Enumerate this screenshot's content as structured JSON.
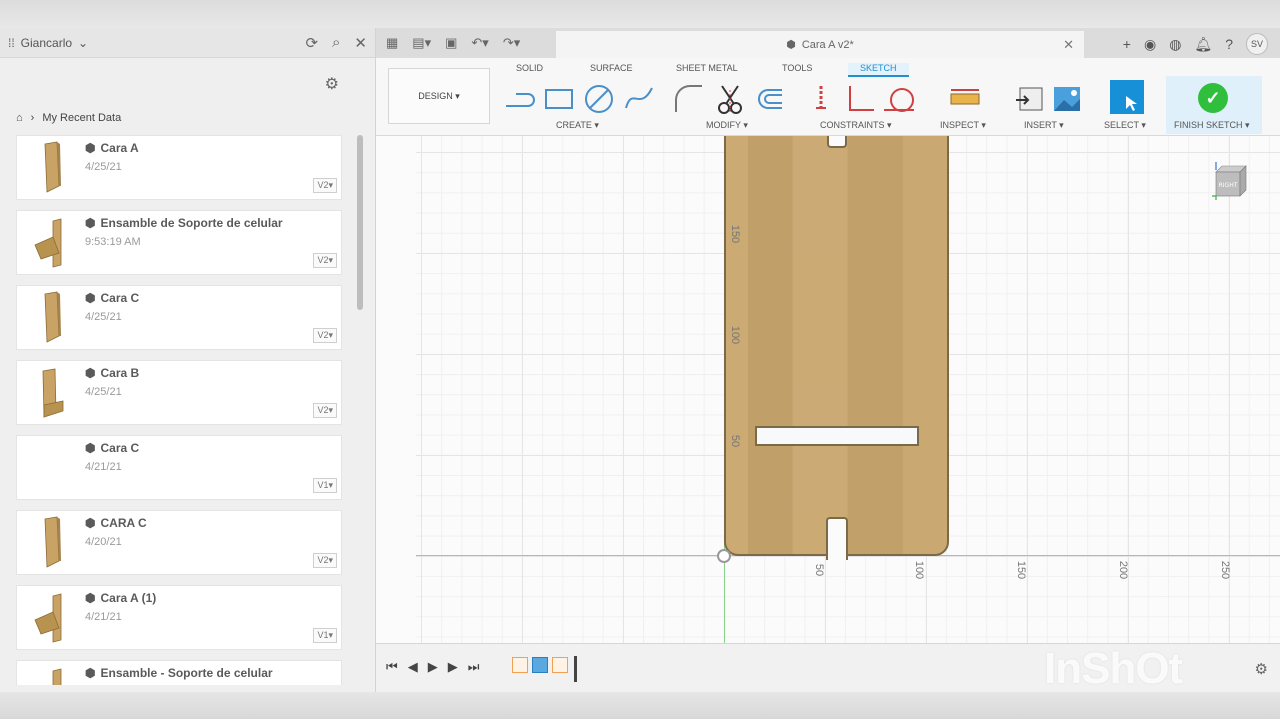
{
  "data_panel": {
    "team_name": "Giancarlo",
    "breadcrumb_label": "My Recent Data",
    "items": [
      {
        "name": "Cara A",
        "date": "4/25/21",
        "version": "V2▾",
        "thumb": "plate"
      },
      {
        "name": "Ensamble de Soporte de celular",
        "date": "9:53:19 AM",
        "version": "V2▾",
        "thumb": "stand"
      },
      {
        "name": "Cara C",
        "date": "4/25/21",
        "version": "V2▾",
        "thumb": "plate"
      },
      {
        "name": "Cara B",
        "date": "4/25/21",
        "version": "V2▾",
        "thumb": "plate-l"
      },
      {
        "name": "Cara C",
        "date": "4/21/21",
        "version": "V1▾",
        "thumb": "none"
      },
      {
        "name": "CARA C",
        "date": "4/20/21",
        "version": "V2▾",
        "thumb": "plate"
      },
      {
        "name": "Cara A (1)",
        "date": "4/21/21",
        "version": "V1▾",
        "thumb": "stand"
      },
      {
        "name": "Ensamble - Soporte de celular",
        "date": "",
        "version": "",
        "thumb": "stand"
      }
    ]
  },
  "tabbar": {
    "doc_title": "Cara A v2*",
    "avatar_initials": "SV"
  },
  "toolbar": {
    "workspace_label": "DESIGN ▾",
    "tabs": {
      "solid": "SOLID",
      "surface": "SURFACE",
      "sheet_metal": "SHEET METAL",
      "tools": "TOOLS",
      "sketch": "SKETCH"
    },
    "groups": {
      "create": "CREATE ▾",
      "modify": "MODIFY ▾",
      "constraints": "CONSTRAINTS ▾",
      "inspect": "INSPECT ▾",
      "insert": "INSERT ▾",
      "select": "SELECT ▾",
      "finish": "FINISH SKETCH ▾"
    }
  },
  "canvas": {
    "v_labels": [
      "150",
      "100",
      "50"
    ],
    "h_labels": [
      "50",
      "100",
      "150",
      "200",
      "250"
    ],
    "viewcube_label": "RIGHT"
  },
  "watermark": "InShOt",
  "colors": {
    "accent": "#1890d7",
    "finish_green": "#2fbf3d",
    "wood": "#c8a56c"
  }
}
